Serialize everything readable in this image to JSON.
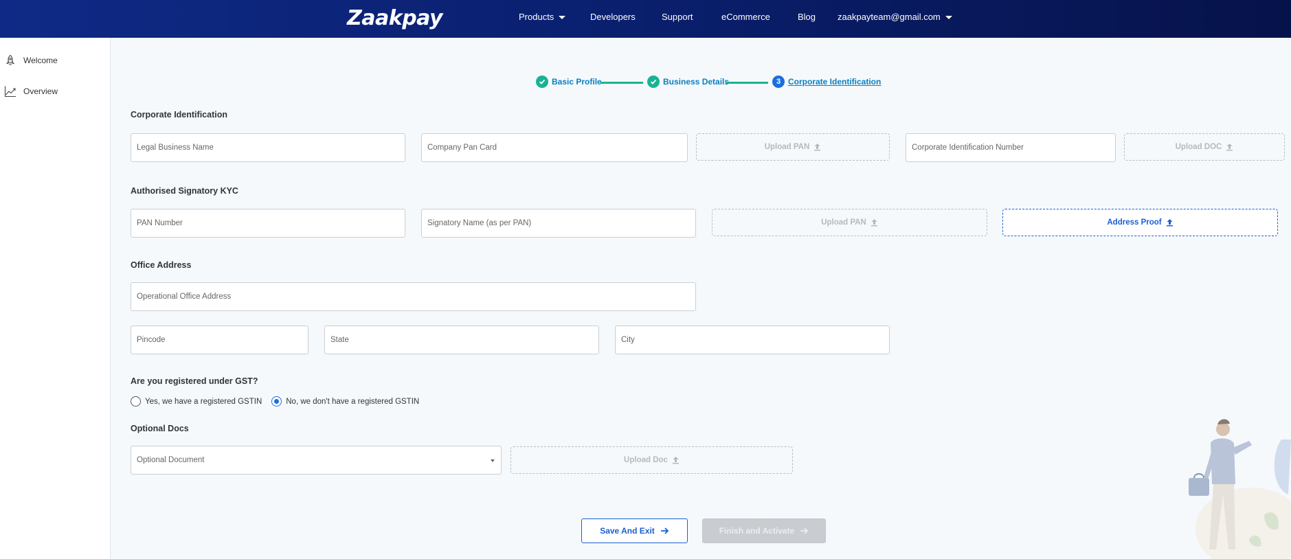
{
  "header": {
    "logo_text": "Zaakpay",
    "nav": {
      "products": "Products",
      "developers": "Developers",
      "support": "Support",
      "ecommerce": "eCommerce",
      "blog": "Blog",
      "account": "zaakpayteam@gmail.com"
    }
  },
  "sidebar": {
    "items": [
      {
        "label": "Welcome",
        "icon": "rocket-icon"
      },
      {
        "label": "Overview",
        "icon": "trend-chart-icon"
      }
    ]
  },
  "stepper": {
    "steps": [
      {
        "label": "Basic Profile",
        "status": "done"
      },
      {
        "label": "Business Details",
        "status": "done"
      },
      {
        "label": "Corporate Identification",
        "status": "current",
        "number": "3"
      }
    ]
  },
  "sections": {
    "corporate": {
      "title": "Corporate Identification",
      "legal_name_placeholder": "Legal Business Name",
      "company_pan_placeholder": "Company Pan Card",
      "upload_pan": "Upload PAN",
      "cin_placeholder": "Corporate Identification Number",
      "upload_doc": "Upload DOC"
    },
    "signatory": {
      "title": "Authorised Signatory KYC",
      "pan_number_placeholder": "PAN Number",
      "signatory_name_placeholder": "Signatory Name (as per PAN)",
      "upload_pan": "Upload PAN",
      "address_proof": "Address Proof"
    },
    "office": {
      "title": "Office Address",
      "address_placeholder": "Operational Office Address",
      "pincode_placeholder": "Pincode",
      "state_placeholder": "State",
      "city_placeholder": "City"
    },
    "gst": {
      "question": "Are you registered under GST?",
      "options": [
        {
          "label": "Yes, we have a registered GSTIN",
          "checked": false
        },
        {
          "label": "No, we don't have a registered GSTIN",
          "checked": true
        }
      ]
    },
    "optional": {
      "title": "Optional Docs",
      "select_value": "Optional Document",
      "upload_doc": "Upload Doc"
    }
  },
  "actions": {
    "save_exit": "Save And Exit",
    "finish_activate": "Finish and Activate"
  },
  "colors": {
    "nav_bg": "#0a2070",
    "accent": "#1a5fd0",
    "step_done": "#19b394",
    "step_link": "#0a7fc0"
  }
}
